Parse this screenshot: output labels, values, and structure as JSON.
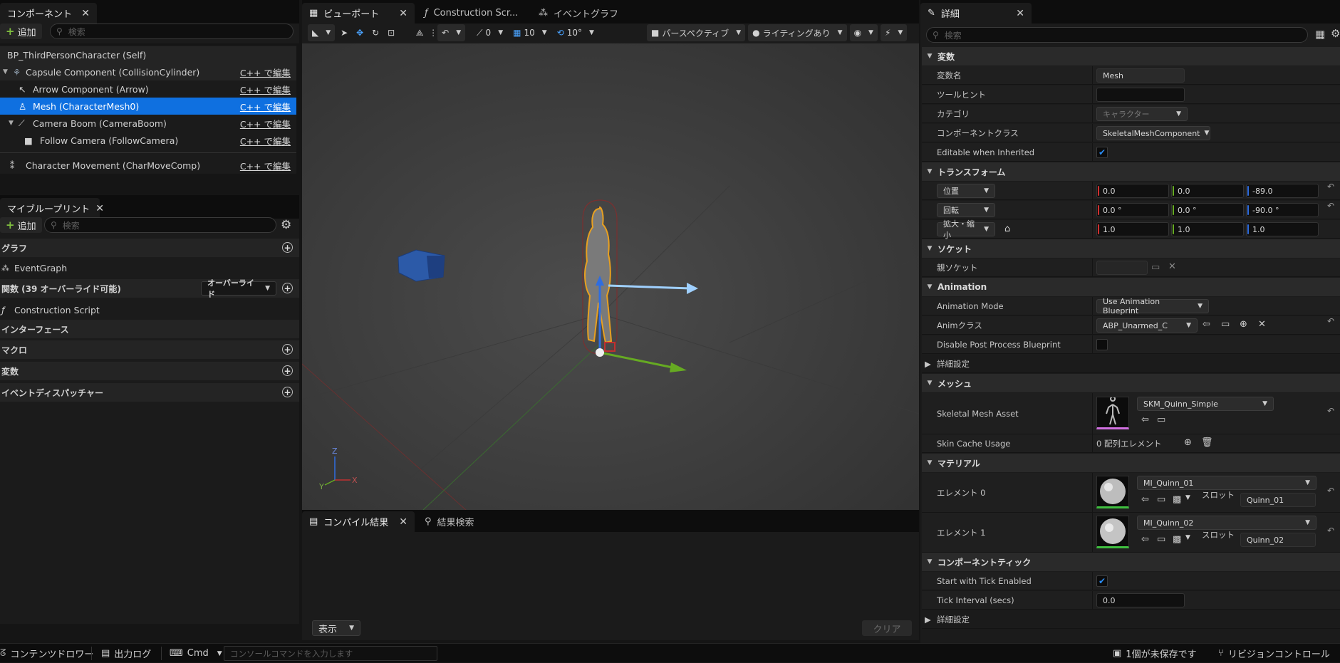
{
  "components_panel": {
    "tab_label": "コンポーネント",
    "add_label": "追加",
    "search_placeholder": "検索",
    "items": [
      {
        "label": "BP_ThirdPersonCharacter (Self)",
        "edit": ""
      },
      {
        "label": "Capsule Component (CollisionCylinder)",
        "edit": "C++ で編集"
      },
      {
        "label": "Arrow Component (Arrow)",
        "edit": "C++ で編集"
      },
      {
        "label": "Mesh (CharacterMesh0)",
        "edit": "C++ で編集"
      },
      {
        "label": "Camera Boom (CameraBoom)",
        "edit": "C++ で編集"
      },
      {
        "label": "Follow Camera (FollowCamera)",
        "edit": "C++ で編集"
      },
      {
        "label": "Character Movement (CharMoveComp)",
        "edit": "C++ で編集"
      }
    ]
  },
  "myblueprint_panel": {
    "tab_label": "マイブループリント",
    "add_label": "追加",
    "search_placeholder": "検索",
    "sections": {
      "graph": "グラフ",
      "event_graph": "EventGraph",
      "functions": "関数 (39 オーバーライド可能)",
      "override": "オーバーライド",
      "construction_script": "Construction Script",
      "interface": "インターフェース",
      "macro": "マクロ",
      "variables": "変数",
      "dispatchers": "イベントディスパッチャー"
    }
  },
  "center_tabs": {
    "viewport": "ビューポート",
    "construction": "Construction Scr...",
    "event_graph": "イベントグラフ"
  },
  "viewport_toolbar": {
    "rotate_snap": "0",
    "grid_snap": "10",
    "angle_snap": "10°",
    "perspective": "パースペクティブ",
    "lighting": "ライティングあり"
  },
  "bottom_tabs": {
    "compile_results": "コンパイル結果",
    "find_results": "結果検索",
    "show_label": "表示",
    "clear_label": "クリア"
  },
  "details_panel": {
    "tab_label": "詳細",
    "search_placeholder": "検索",
    "variable_section": "変数",
    "variable_name_label": "変数名",
    "variable_name_value": "Mesh",
    "tooltip_label": "ツールヒント",
    "category_label": "カテゴリ",
    "category_value": "キャラクター",
    "component_class_label": "コンポーネントクラス",
    "component_class_value": "SkeletalMeshComponent",
    "editable_label": "Editable when Inherited",
    "transform_section": "トランスフォーム",
    "location_label": "位置",
    "location": [
      "0.0",
      "0.0",
      "-89.0"
    ],
    "rotation_label": "回転",
    "rotation": [
      "0.0 °",
      "0.0 °",
      "-90.0 °"
    ],
    "scale_label": "拡大・縮小",
    "scale": [
      "1.0",
      "1.0",
      "1.0"
    ],
    "socket_section": "ソケット",
    "parent_socket_label": "親ソケット",
    "animation_section": "Animation",
    "anim_mode_label": "Animation Mode",
    "anim_mode_value": "Use Animation Blueprint",
    "anim_class_label": "Animクラス",
    "anim_class_value": "ABP_Unarmed_C",
    "disable_pp_label": "Disable Post Process Blueprint",
    "advanced_label": "詳細設定",
    "mesh_section": "メッシュ",
    "skeletal_mesh_label": "Skeletal Mesh Asset",
    "skeletal_mesh_value": "SKM_Quinn_Simple",
    "skin_cache_label": "Skin Cache Usage",
    "skin_cache_value": "0 配列エレメント",
    "material_section": "マテリアル",
    "element0_label": "エレメント 0",
    "element0_value": "MI_Quinn_01",
    "element0_slot": "Quinn_01",
    "element1_label": "エレメント 1",
    "element1_value": "MI_Quinn_02",
    "element1_slot": "Quinn_02",
    "slot_label": "スロット",
    "tick_section": "コンポーネントティック",
    "tick_enabled_label": "Start with Tick Enabled",
    "tick_interval_label": "Tick Interval (secs)",
    "tick_interval_value": "0.0",
    "advanced2_label": "詳細設定"
  },
  "status_bar": {
    "content_drawer": "コンテンツドロワー",
    "output_log": "出力ログ",
    "cmd": "Cmd",
    "console_placeholder": "コンソールコマンドを入力します",
    "unsaved": "1個が未保存です",
    "revision_control": "リビジョンコントロール"
  },
  "colors": {
    "accent": "#0f70e0",
    "selection": "#0f70e0",
    "axis_x": "#d03030",
    "axis_y": "#66aa22",
    "axis_z": "#2f6de0"
  }
}
